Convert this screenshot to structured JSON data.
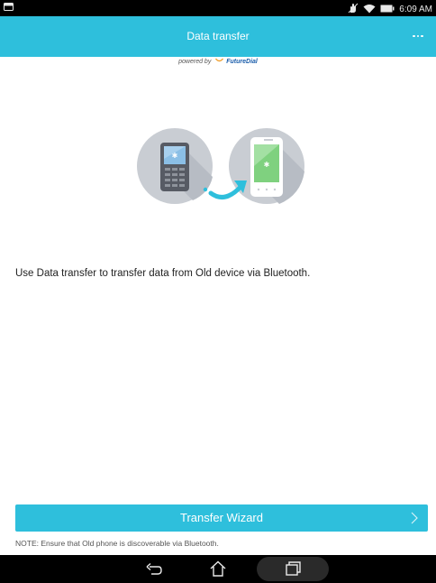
{
  "status_bar": {
    "time": "6:09 AM",
    "icons": [
      "notification-card-icon",
      "hand-icon",
      "wifi-icon",
      "battery-icon"
    ]
  },
  "app_bar": {
    "title": "Data transfer",
    "overflow_icon": "more-horizontal-icon"
  },
  "powered_by": {
    "prefix": "powered by",
    "brand": "FutureDial"
  },
  "main": {
    "description": "Use Data transfer to transfer data from Old device via Bluetooth.",
    "wizard_button_label": "Transfer Wizard",
    "note": "NOTE: Ensure that Old phone is discoverable via Bluetooth."
  },
  "nav_bar": {
    "buttons": [
      "back-icon",
      "home-icon",
      "recents-icon"
    ]
  },
  "colors": {
    "accent": "#2ebfdc",
    "status_bar": "#000000",
    "nav_bar": "#000000",
    "illustration_circle": "#c9cdd3"
  }
}
